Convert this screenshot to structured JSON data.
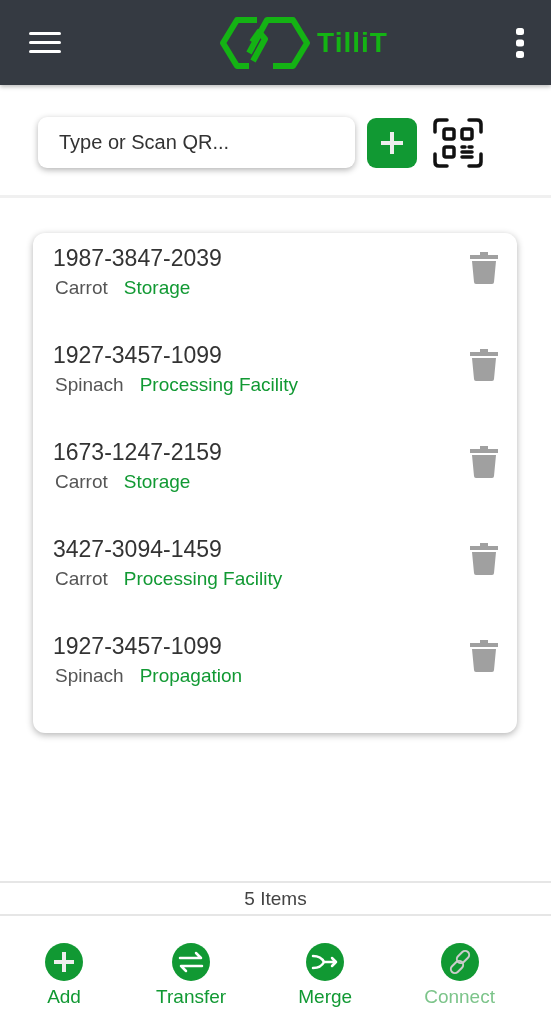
{
  "header": {
    "brand": "TilliT"
  },
  "search": {
    "placeholder": "Type or Scan QR..."
  },
  "items": [
    {
      "code": "1987-3847-2039",
      "product": "Carrot",
      "location": "Storage"
    },
    {
      "code": "1927-3457-1099",
      "product": "Spinach",
      "location": "Processing Facility"
    },
    {
      "code": "1673-1247-2159",
      "product": "Carrot",
      "location": "Storage"
    },
    {
      "code": "3427-3094-1459",
      "product": "Carrot",
      "location": "Processing Facility"
    },
    {
      "code": "1927-3457-1099",
      "product": "Spinach",
      "location": "Propagation"
    }
  ],
  "count": "5 Items",
  "actions": [
    {
      "kind": "add",
      "label": "Add",
      "disabled": false
    },
    {
      "kind": "transfer",
      "label": "Transfer",
      "disabled": false
    },
    {
      "kind": "merge",
      "label": "Merge",
      "disabled": false
    },
    {
      "kind": "connect",
      "label": "Connect",
      "disabled": true
    }
  ]
}
